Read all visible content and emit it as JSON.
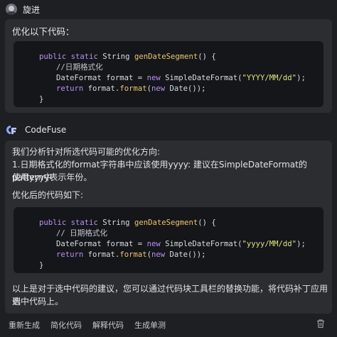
{
  "user": {
    "name": "旋进"
  },
  "user_message": {
    "prompt": "优化以下代码：",
    "code": {
      "l1_kw1": "public static ",
      "l1_type": "String ",
      "l1_fn": "genDateSegment",
      "l1_rest": "() {",
      "l2_comment": "//日期格式化",
      "l3_type": "DateFormat format = ",
      "l3_new": "new ",
      "l3_cls": "SimpleDateFormat(",
      "l3_str": "\"YYYY/MM/dd\"",
      "l3_end": ");",
      "l4_ret": "return ",
      "l4_obj": "format.",
      "l4_fn": "format",
      "l4_open": "(",
      "l4_new": "new ",
      "l4_end": "Date());",
      "l5": "}"
    }
  },
  "bot": {
    "name": "CodeFuse"
  },
  "bot_message": {
    "intro": "我们分析针对所选代码可能的优化方向:",
    "point1_a": "1.日期格式化的format字符串中应该使用yyyy: 建议在SimpleDateFormat的pattern中",
    "point1_b": "使用yyyy表示年份。",
    "after_label": "优化后的代码如下:",
    "code": {
      "l1_kw1": "public static ",
      "l1_type": "String ",
      "l1_fn": "genDateSegment",
      "l1_rest": "() {",
      "l2_comment": "// 日期格式化",
      "l3_type": "DateFormat format = ",
      "l3_new": "new ",
      "l3_cls": "SimpleDateFormat(",
      "l3_str": "\"yyyy/MM/dd\"",
      "l3_end": ");",
      "l4_ret": "return ",
      "l4_obj": "format.",
      "l4_fn": "format",
      "l4_open": "(",
      "l4_new": "new ",
      "l4_end": "Date());",
      "l5": "}"
    },
    "outro_a": "以上是对于选中代码的建议，您可以通过代码块工具栏的替换功能，将代码补丁应用到",
    "outro_b": "选中代码上。"
  },
  "actions": {
    "regenerate": "重新生成",
    "simplify": "简化代码",
    "explain": "解释代码",
    "generate_tests": "生成单测"
  },
  "colors": {
    "background": "#1e1f22",
    "panel": "#2b2d31",
    "code_background": "#14161a",
    "keyword": "#ba8ff0",
    "function": "#f0c36b",
    "string": "#e0e27c"
  }
}
